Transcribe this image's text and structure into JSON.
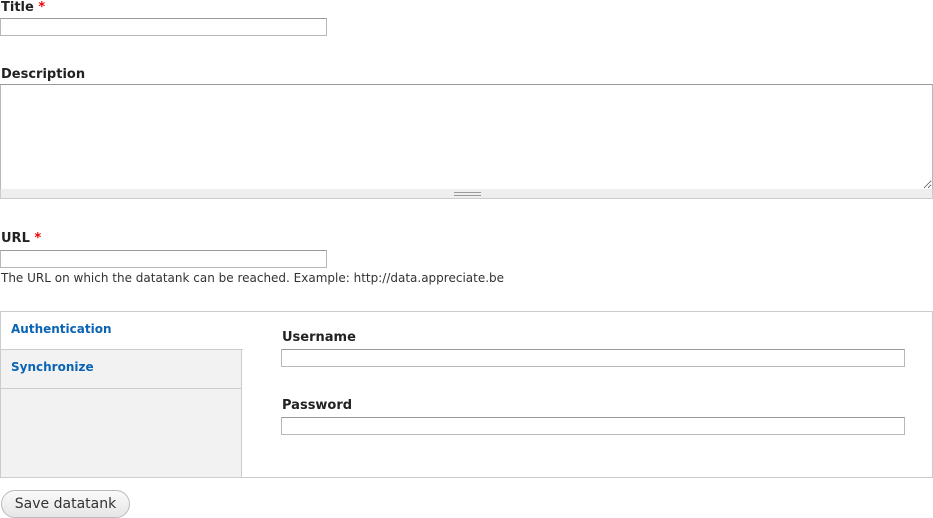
{
  "title_field": {
    "label": "Title",
    "required": "*",
    "value": ""
  },
  "description_field": {
    "label": "Description",
    "value": ""
  },
  "url_field": {
    "label": "URL",
    "required": "*",
    "value": "",
    "help": "The URL on which the datatank can be reached. Example: http://data.appreciate.be"
  },
  "tabs": [
    {
      "label": "Authentication",
      "active": true
    },
    {
      "label": "Synchronize",
      "active": false
    }
  ],
  "auth": {
    "username_label": "Username",
    "username_value": "",
    "password_label": "Password",
    "password_value": ""
  },
  "save_label": "Save datatank"
}
